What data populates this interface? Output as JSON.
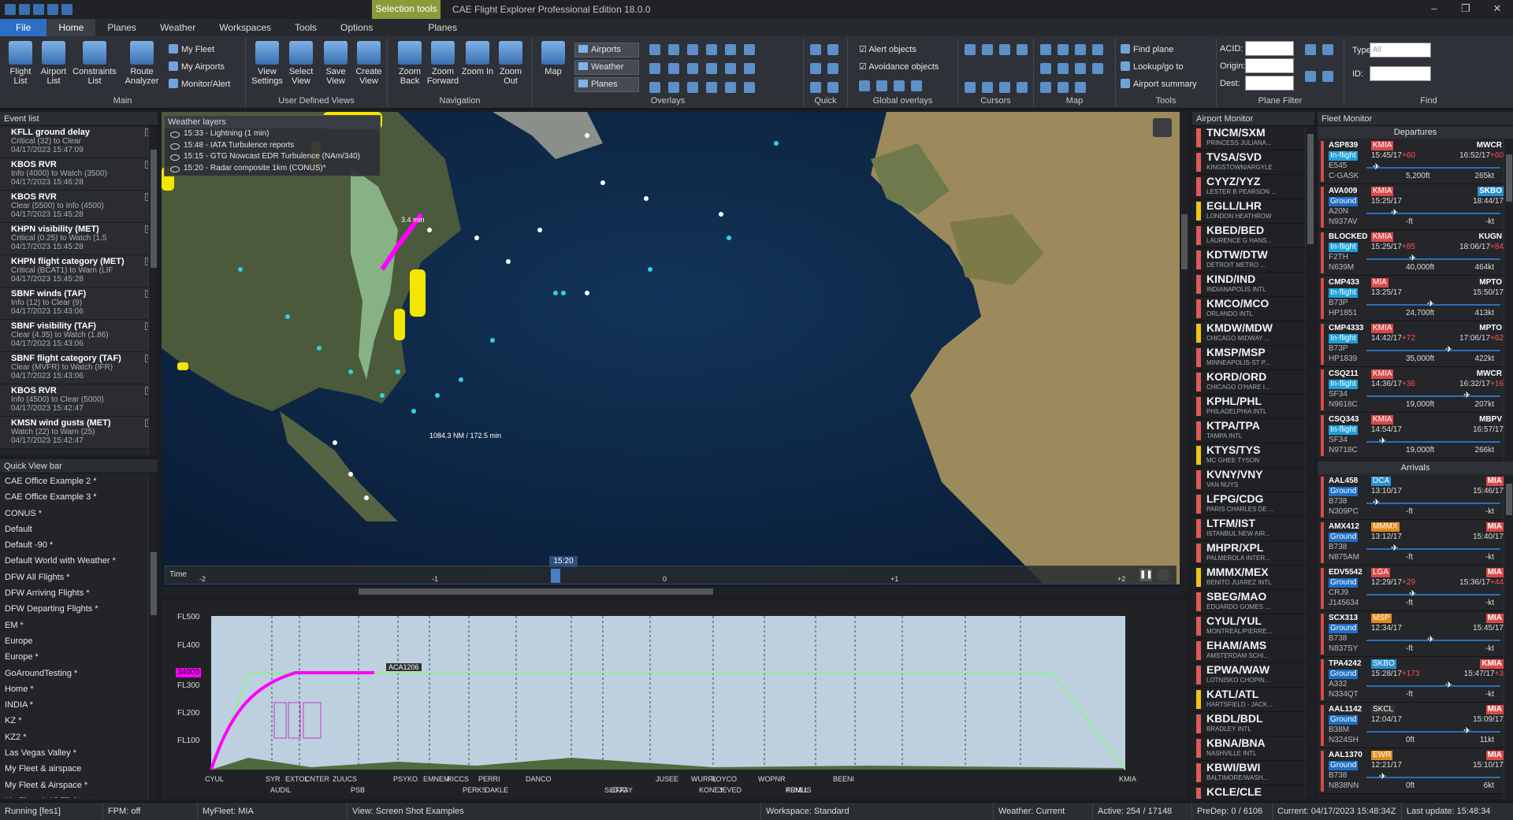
{
  "title_bar": {
    "context_tab": "Selection tools",
    "app_title": "CAE Flight Explorer Professional Edition 18.0.0"
  },
  "tabs": [
    {
      "label": "File"
    },
    {
      "label": "Home"
    },
    {
      "label": "Planes"
    },
    {
      "label": "Weather"
    },
    {
      "label": "Workspaces"
    },
    {
      "label": "Tools"
    },
    {
      "label": "Options"
    },
    {
      "label": "Planes"
    }
  ],
  "ribbon": {
    "main": {
      "label": "Main",
      "flight_list": "Flight List",
      "airport_list": "Airport List",
      "constraints_list": "Constraints List",
      "route_analyzer": "Route Analyzer",
      "my_fleet": "My Fleet",
      "my_airports": "My Airports",
      "monitor_alert": "Monitor/Alert"
    },
    "udv": {
      "label": "User Defined Views",
      "view_settings": "View Settings",
      "select_view": "Select View",
      "save_view": "Save View",
      "create_view": "Create View"
    },
    "nav": {
      "label": "Navigation",
      "zoom_back": "Zoom Back",
      "zoom_forward": "Zoom Forward",
      "zoom_in": "Zoom In",
      "zoom_out": "Zoom Out"
    },
    "overlays": {
      "label": "Overlays",
      "map": "Map",
      "airports": "Airports",
      "weather": "Weather",
      "planes": "Planes"
    },
    "quick": {
      "label": "Quick"
    },
    "global": {
      "label": "Global overlays",
      "alert_objects": "Alert objects",
      "avoidance_objects": "Avoidance objects"
    },
    "cursors": {
      "label": "Cursors"
    },
    "map_grp": {
      "label": "Map"
    },
    "tools": {
      "label": "Tools",
      "find_plane": "Find plane",
      "lookup": "Lookup/go to",
      "airport_summary": "Airport summary"
    },
    "plane_filter": {
      "label": "Plane Filter",
      "acid": "ACID:",
      "origin": "Origin:",
      "dest": "Dest:"
    },
    "find": {
      "label": "Find",
      "type": "Type:",
      "type_value": "All",
      "id": "ID:"
    }
  },
  "event_list": {
    "title": "Event list",
    "items": [
      {
        "t": "KFLL ground delay",
        "d1": "Critical (32) to Clear",
        "d2": "04/17/2023 15:47:09"
      },
      {
        "t": "KBOS RVR",
        "d1": "Info (4000) to Watch (3500)",
        "d2": "04/17/2023 15:46:28"
      },
      {
        "t": "KBOS RVR",
        "d1": "Clear (5500) to Info (4500)",
        "d2": "04/17/2023 15:45:28"
      },
      {
        "t": "KHPN visibility (MET)",
        "d1": "Critical (0.25) to Watch (1.5",
        "d2": "04/17/2023 15:45:28"
      },
      {
        "t": "KHPN flight category (MET)",
        "d1": "Critical (BCAT1) to Warn (LIF",
        "d2": "04/17/2023 15:45:28"
      },
      {
        "t": "SBNF winds (TAF)",
        "d1": "Info (12) to Clear (9)",
        "d2": "04/17/2023 15:43:06"
      },
      {
        "t": "SBNF visibility (TAF)",
        "d1": "Clear (4.35) to Watch (1.86)",
        "d2": "04/17/2023 15:43:06"
      },
      {
        "t": "SBNF flight category (TAF)",
        "d1": "Clear (MVFR) to Watch (IFR)",
        "d2": "04/17/2023 15:43:06"
      },
      {
        "t": "KBOS RVR",
        "d1": "Info (4500) to Clear (5000)",
        "d2": "04/17/2023 15:42:47"
      },
      {
        "t": "KMSN wind gusts (MET)",
        "d1": "Watch (22) to Warn (25)",
        "d2": "04/17/2023 15:42:47"
      }
    ]
  },
  "quick_view": {
    "title": "Quick View bar",
    "items": [
      "CAE Office Example 2 *",
      "CAE Office Example 3 *",
      "CONUS *",
      "Default",
      "Default -90 *",
      "Default World with Weather *",
      "DFW All Flights *",
      "DFW Arriving Flights *",
      "DFW Departing Flights *",
      "EM *",
      "Europe",
      "Europe *",
      "GoAroundTesting *",
      "Home *",
      "INDIA *",
      "KZ *",
      "KZ2 *",
      "Las Vegas Valley *",
      "My Fleet & airspace",
      "My Fleet & Airspace *",
      "My Fleet & All Flights *"
    ]
  },
  "weather_layers": {
    "title": "Weather layers",
    "items": [
      "15:33 - Lightning (1 min)",
      "15:48 - IATA Turbulence reports",
      "15:15 - GTG Nowcast EDR Turbulence (NAm/340)",
      "15:20 - Radar composite 1km (CONUS)*"
    ]
  },
  "map": {
    "measure1": "3.4 min",
    "measure2": "1084.3 NM / 172.5 min"
  },
  "timeline": {
    "label": "Time",
    "current": "15:20",
    "ticks": [
      "-2",
      "-1",
      "0",
      "+1",
      "+2"
    ]
  },
  "profile": {
    "levels": [
      "FL500",
      "FL400",
      "FL300",
      "FL200",
      "FL100"
    ],
    "current_level": "34000",
    "flight": "ACA1206",
    "waypoints": [
      "CYUL",
      "SYR",
      "AUDIL",
      "EXTOL",
      "CNTER",
      "ZUUCS",
      "PSB",
      "PSYKO",
      "EMNEM",
      "RICCS",
      "PERKS",
      "PERRI",
      "OAKLE",
      "DANCO",
      "SLOJO",
      "EFFAY",
      "JUSEE",
      "WURFL",
      "KONEY",
      "ROYCO",
      "JEVED",
      "WOPNR",
      "PRMUS",
      "KENLL",
      "BEENI",
      "KMIA"
    ]
  },
  "airport_monitor": {
    "title": "Airport Monitor",
    "items": [
      {
        "c": "TNCM/SXM",
        "n": "PRINCESS JULIANA..."
      },
      {
        "c": "TVSA/SVD",
        "n": "KINGSTOWN/ARGYLE"
      },
      {
        "c": "CYYZ/YYZ",
        "n": "LESTER B PEARSON ..."
      },
      {
        "c": "EGLL/LHR",
        "n": "LONDON HEATHROW"
      },
      {
        "c": "KBED/BED",
        "n": "LAURENCE G HANS..."
      },
      {
        "c": "KDTW/DTW",
        "n": "DETROIT METRO ..."
      },
      {
        "c": "KIND/IND",
        "n": "INDIANAPOLIS INTL"
      },
      {
        "c": "KMCO/MCO",
        "n": "ORLANDO INTL"
      },
      {
        "c": "KMDW/MDW",
        "n": "CHICAGO MIDWAY ..."
      },
      {
        "c": "KMSP/MSP",
        "n": "MINNEAPOLIS-ST P..."
      },
      {
        "c": "KORD/ORD",
        "n": "CHICAGO O'HARE I..."
      },
      {
        "c": "KPHL/PHL",
        "n": "PHILADELPHIA INTL"
      },
      {
        "c": "KTPA/TPA",
        "n": "TAMPA INTL"
      },
      {
        "c": "KTYS/TYS",
        "n": "MC GHEE TYSON"
      },
      {
        "c": "KVNY/VNY",
        "n": "VAN NUYS"
      },
      {
        "c": "LFPG/CDG",
        "n": "PARIS CHARLES DE ..."
      },
      {
        "c": "LTFM/IST",
        "n": "ISTANBUL NEW AIR..."
      },
      {
        "c": "MHPR/XPL",
        "n": "PALMEROLA INTER..."
      },
      {
        "c": "MMMX/MEX",
        "n": "BENITO JUAREZ INTL"
      },
      {
        "c": "SBEG/MAO",
        "n": "EDUARDO GOMES ..."
      },
      {
        "c": "CYUL/YUL",
        "n": "MONTREAL/PIERRE..."
      },
      {
        "c": "EHAM/AMS",
        "n": "AMSTERDAM SCHI..."
      },
      {
        "c": "EPWA/WAW",
        "n": "LOTNISKO CHOPIN..."
      },
      {
        "c": "KATL/ATL",
        "n": "HARTSFIELD - JACK..."
      },
      {
        "c": "KBDL/BDL",
        "n": "BRADLEY INTL"
      },
      {
        "c": "KBNA/BNA",
        "n": "NASHVILLE INTL"
      },
      {
        "c": "KBWI/BWI",
        "n": "BALTIMORE/WASH..."
      },
      {
        "c": "KCLE/CLE",
        "n": ""
      }
    ]
  },
  "fleet_monitor": {
    "title": "Fleet Monitor",
    "departures": "Departures",
    "arrivals": "Arrivals",
    "dep": [
      {
        "cs": "ASP839",
        "o": "KMIA",
        "d": "MWCR",
        "st": "In-flight",
        "t1": "15:45/17",
        "t1d": "+60",
        "t2": "16:52/17",
        "t2d": "+60",
        "ty": "E545",
        "rg": "C-GASK",
        "al": "5,200ft",
        "sp": "265kt"
      },
      {
        "cs": "AVA009",
        "o": "KMIA",
        "d": "SKBO",
        "st": "Ground",
        "t1": "15:25/17",
        "t1d": "",
        "t2": "18:44/17",
        "t2d": "",
        "ty": "A20N",
        "rg": "N937AV",
        "al": "-ft",
        "sp": "-kt"
      },
      {
        "cs": "BLOCKED",
        "o": "KMIA",
        "d": "KUGN",
        "st": "In-flight",
        "t1": "15:25/17",
        "t1d": "+85",
        "t2": "18:06/17",
        "t2d": "+84",
        "ty": "F2TH",
        "rg": "N639M",
        "al": "40,000ft",
        "sp": "464kt"
      },
      {
        "cs": "CMP433",
        "o": "MIA",
        "d": "MPTO",
        "st": "In-flight",
        "t1": "13:25/17",
        "t1d": "",
        "t2": "15:50/17",
        "t2d": "",
        "ty": "B73P",
        "rg": "HP1851",
        "al": "24,700ft",
        "sp": "413kt"
      },
      {
        "cs": "CMP4333",
        "o": "KMIA",
        "d": "MPTO",
        "st": "In-flight",
        "t1": "14:42/17",
        "t1d": "+72",
        "t2": "17:06/17",
        "t2d": "+62",
        "ty": "B73P",
        "rg": "HP1839",
        "al": "35,000ft",
        "sp": "422kt"
      },
      {
        "cs": "CSQ211",
        "o": "KMIA",
        "d": "MWCR",
        "st": "In-flight",
        "t1": "14:36/17",
        "t1d": "+36",
        "t2": "16:32/17",
        "t2d": "+16",
        "ty": "SF34",
        "rg": "N9618C",
        "al": "19,000ft",
        "sp": "207kt"
      },
      {
        "cs": "CSQ343",
        "o": "KMIA",
        "d": "MBPV",
        "st": "In-flight",
        "t1": "14:54/17",
        "t1d": "",
        "t2": "16:57/17",
        "t2d": "",
        "ty": "SF34",
        "rg": "N9718C",
        "al": "19,000ft",
        "sp": "266kt"
      }
    ],
    "arr": [
      {
        "cs": "AAL458",
        "o": "DCA",
        "d": "MIA",
        "st": "Ground",
        "t1": "13:10/17",
        "t1d": "",
        "t2": "15:46/17",
        "t2d": "",
        "ty": "B738",
        "rg": "N309PC",
        "al": "-ft",
        "sp": "-kt"
      },
      {
        "cs": "AMX412",
        "o": "MMMX",
        "d": "MIA",
        "st": "Ground",
        "t1": "13:12/17",
        "t1d": "",
        "t2": "15:40/17",
        "t2d": "",
        "ty": "B738",
        "rg": "N875AM",
        "al": "-ft",
        "sp": "-kt"
      },
      {
        "cs": "EDV5542",
        "o": "LGA",
        "d": "MIA",
        "st": "Ground",
        "t1": "12:29/17",
        "t1d": "+29",
        "t2": "15:36/17",
        "t2d": "+44",
        "ty": "CRJ9",
        "rg": "J145634",
        "al": "-ft",
        "sp": "-kt"
      },
      {
        "cs": "SCX313",
        "o": "MSP",
        "d": "MIA",
        "st": "Ground",
        "t1": "12:34/17",
        "t1d": "",
        "t2": "15:45/17",
        "t2d": "",
        "ty": "B738",
        "rg": "N837SY",
        "al": "-ft",
        "sp": "-kt"
      },
      {
        "cs": "TPA4242",
        "o": "SKBO",
        "d": "KMIA",
        "st": "Ground",
        "t1": "15:28/17",
        "t1d": "+173",
        "t2": "15:47/17",
        "t2d": "+3",
        "ty": "A332",
        "rg": "N334QT",
        "al": "-ft",
        "sp": "-kt"
      },
      {
        "cs": "AAL1142",
        "o": "SKCL",
        "d": "MIA",
        "st": "Ground",
        "t1": "12:04/17",
        "t1d": "",
        "t2": "15:09/17",
        "t2d": "",
        "ty": "B38M",
        "rg": "N324SH",
        "al": "0ft",
        "sp": "11kt"
      },
      {
        "cs": "AAL1370",
        "o": "EWR",
        "d": "MIA",
        "st": "Ground",
        "t1": "12:21/17",
        "t1d": "",
        "t2": "15:10/17",
        "t2d": "",
        "ty": "B738",
        "rg": "N838NN",
        "al": "0ft",
        "sp": "6kt"
      }
    ]
  },
  "status": {
    "running": "Running [fes1]",
    "fpm": "FPM: off",
    "myfleet": "MyFleet: MIA",
    "view": "View: Screen Shot Examples",
    "workspace": "Workspace: Standard",
    "weather": "Weather: Current",
    "active": "Active: 254 / 17148",
    "predep": "PreDep: 0 / 6106",
    "current": "Current: 04/17/2023 15:48:34Z",
    "last": "Last update: 15:48:34"
  },
  "colors": {
    "accent": "#2c6fc4",
    "context": "#8a9c3a",
    "alert": "#d94848",
    "profile_flight": "#ff00ff",
    "profile_plan": "#90ee90"
  }
}
